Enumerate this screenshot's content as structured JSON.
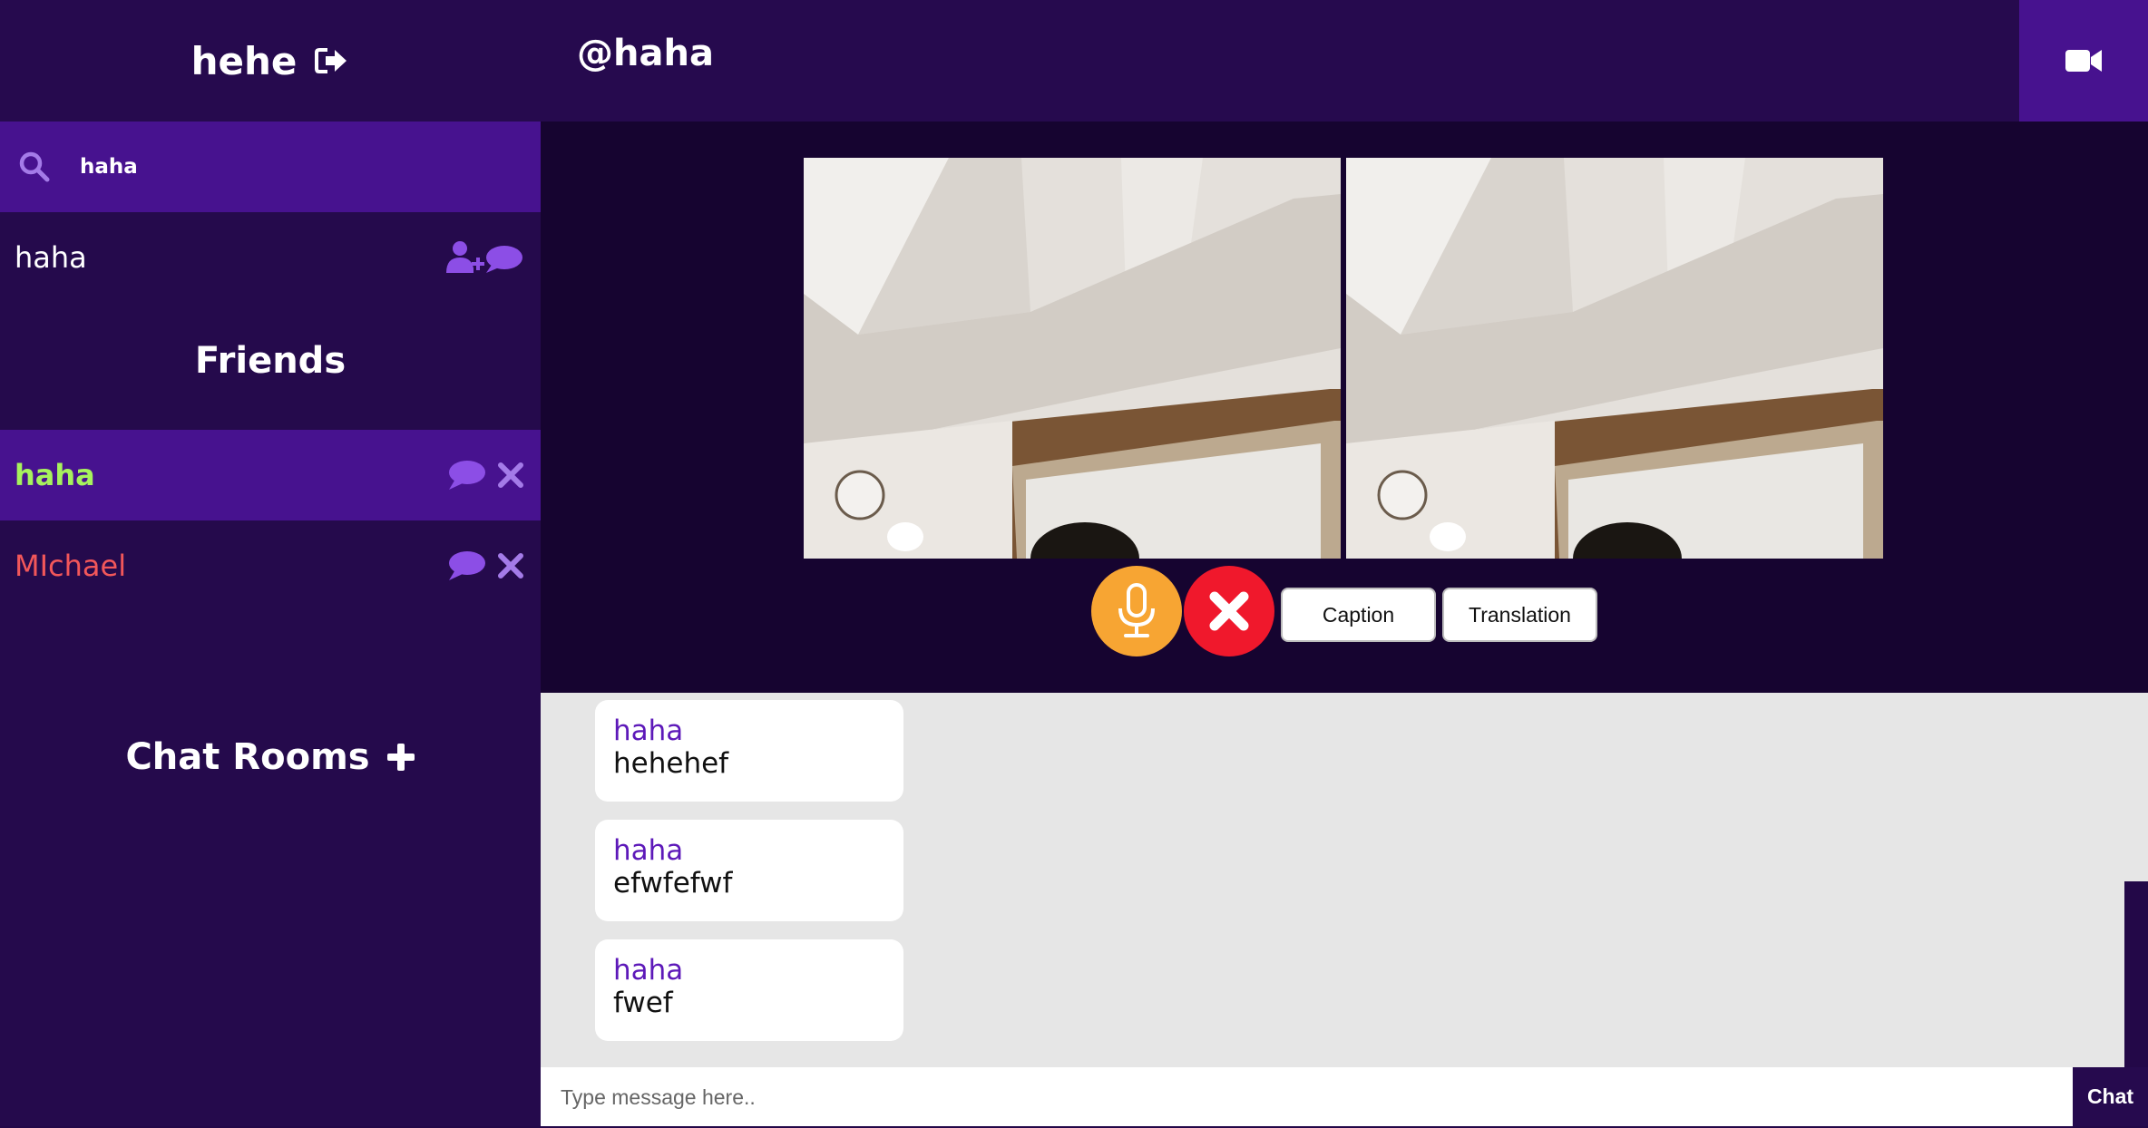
{
  "user": {
    "name": "hehe",
    "logout_icon": "logout-icon"
  },
  "search": {
    "value": "haha",
    "placeholder": ""
  },
  "search_result": {
    "name": "haha",
    "icon": "add-friend-chat-icon"
  },
  "friends": {
    "title": "Friends",
    "items": [
      {
        "name": "haha",
        "status": "active",
        "color": "#a7f25d"
      },
      {
        "name": "MIchael",
        "status": "inactive",
        "color": "#f2575a"
      }
    ]
  },
  "chat_rooms": {
    "title": "Chat Rooms",
    "add_icon": "plus-icon"
  },
  "chat": {
    "title": "@haha",
    "video_icon": "video-camera-icon"
  },
  "call": {
    "mic_icon": "microphone-icon",
    "hangup_icon": "close-icon",
    "caption_label": "Caption",
    "translation_label": "Translation"
  },
  "messages": [
    {
      "author": "haha",
      "text": "hehehef"
    },
    {
      "author": "haha",
      "text": "efwfefwf"
    },
    {
      "author": "haha",
      "text": "fwef"
    }
  ],
  "composer": {
    "placeholder": "Type message here..",
    "send_label": "Chat"
  },
  "colors": {
    "sidebar_bg": "#250a4c",
    "accent": "#47128f",
    "video_bg": "#160430",
    "mic": "#f7a533",
    "hangup": "#f0182c",
    "author": "#5d19b9"
  }
}
